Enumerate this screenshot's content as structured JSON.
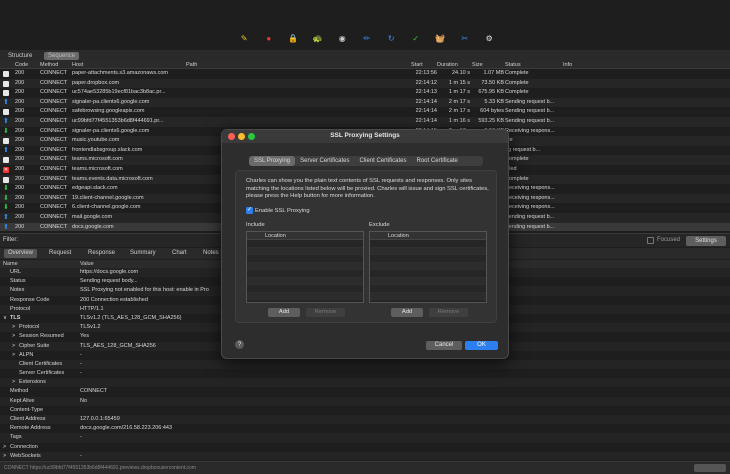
{
  "toolbar": {
    "icons": [
      "pen-icon",
      "record-icon",
      "lock-icon",
      "turtle-icon",
      "breakpoint-icon",
      "compose-icon",
      "repeat-icon",
      "validate-icon",
      "basket-icon",
      "tools-icon",
      "settings-icon"
    ],
    "icon_glyphs": [
      "✎",
      "●",
      "🔒",
      "🐢",
      "◉",
      "✏",
      "↻",
      "✓",
      "🧺",
      "✂",
      "⚙"
    ],
    "icon_colors": [
      "#e0c020",
      "#e53935",
      "#d0d0d0",
      "#d0d0d0",
      "#d0d0d0",
      "#3a8ff0",
      "#3a8ff0",
      "#3ac04a",
      "#3ac04a",
      "#3a8ff0",
      "#e0e0e0"
    ]
  },
  "view_tabs": {
    "structure": "Structure",
    "sequence": "Sequence"
  },
  "columns": [
    "Code",
    "Method",
    "Host",
    "Path",
    "Start",
    "Duration",
    "Size",
    "Status",
    "Info"
  ],
  "rows": [
    {
      "icon": "doc",
      "code": "200",
      "method": "CONNECT",
      "host": "paper-attachments.s3.amazonaws.com",
      "start": "22:13:56",
      "duration": "24.10 s",
      "size": "1.07 MB",
      "status": "Complete"
    },
    {
      "icon": "doc",
      "code": "200",
      "method": "CONNECT",
      "host": "paper.dropbox.com",
      "start": "22:14:12",
      "duration": "1 m 15 s",
      "size": "73.50 KB",
      "status": "Complete"
    },
    {
      "icon": "doc",
      "code": "200",
      "method": "CONNECT",
      "host": "uc574ae53285b19ecf81bac3b8ac.pr...",
      "start": "22:14:13",
      "duration": "1 m 17 s",
      "size": "675.95 KB",
      "status": "Complete"
    },
    {
      "icon": "up",
      "code": "200",
      "method": "CONNECT",
      "host": "signaler-pa.clients6.google.com",
      "start": "22:14:14",
      "duration": "2 m 17 s",
      "size": "5.33 KB",
      "status": "Sending request b..."
    },
    {
      "icon": "doc",
      "code": "200",
      "method": "CONNECT",
      "host": "safebrowsing.googleapis.com",
      "start": "22:14:14",
      "duration": "2 m 17 s",
      "size": "604 bytes",
      "status": "Sending request b..."
    },
    {
      "icon": "up",
      "code": "200",
      "method": "CONNECT",
      "host": "uc99bfd77f4551353b6d8f444691.pr...",
      "start": "22:14:14",
      "duration": "1 m 16 s",
      "size": "593.25 KB",
      "status": "Sending request b..."
    },
    {
      "icon": "down",
      "code": "200",
      "method": "CONNECT",
      "host": "signaler-pa.clients6.google.com",
      "start": "22:14:15",
      "duration": "2 m 17 s",
      "size": "8.50 KB",
      "status": "Receiving respons..."
    },
    {
      "icon": "doc",
      "code": "200",
      "method": "CONNECT",
      "host": "music.youtube.com",
      "start": "",
      "duration": "",
      "size": "",
      "status": "ete"
    },
    {
      "icon": "up",
      "code": "200",
      "method": "CONNECT",
      "host": "frontendlabsgroup.slack.com",
      "start": "",
      "duration": "",
      "size": "",
      "status": "ng request b..."
    },
    {
      "icon": "doc",
      "code": "200",
      "method": "CONNECT",
      "host": "teams.microsoft.com",
      "start": "",
      "duration": "",
      "size": "",
      "status": "Complete"
    },
    {
      "icon": "err",
      "code": "200",
      "method": "CONNECT",
      "host": "teams.microsoft.com",
      "start": "",
      "duration": "",
      "size": "",
      "status": "ailed"
    },
    {
      "icon": "doc",
      "code": "200",
      "method": "CONNECT",
      "host": "teams.events.data.microsoft.com",
      "start": "",
      "duration": "",
      "size": "",
      "status": "Complete"
    },
    {
      "icon": "down",
      "code": "200",
      "method": "CONNECT",
      "host": "edgeapi.slack.com",
      "start": "",
      "duration": "",
      "size": "",
      "status": "Receiving respons..."
    },
    {
      "icon": "down",
      "code": "200",
      "method": "CONNECT",
      "host": "19.client-channel.google.com",
      "start": "",
      "duration": "",
      "size": "",
      "status": "Receiving respons..."
    },
    {
      "icon": "down",
      "code": "200",
      "method": "CONNECT",
      "host": "6.client-channel.google.com",
      "start": "",
      "duration": "",
      "size": "",
      "status": "Receiving respons..."
    },
    {
      "icon": "up",
      "code": "200",
      "method": "CONNECT",
      "host": "mail.google.com",
      "start": "",
      "duration": "",
      "size": "",
      "status": "Sending request b..."
    },
    {
      "icon": "up",
      "code": "200",
      "method": "CONNECT",
      "host": "docs.google.com",
      "start": "",
      "duration": "",
      "size": "",
      "status": "Sending request b..."
    }
  ],
  "filter": {
    "label": "Filter:",
    "focused": "Focused",
    "settings": "Settings"
  },
  "detail_tabs": [
    "Overview",
    "Request",
    "Response",
    "Summary",
    "Chart",
    "Notes"
  ],
  "detail_columns": {
    "name": "Name",
    "value": "Value"
  },
  "detail_rows": [
    {
      "indent": 0,
      "arrow": "",
      "name": "URL",
      "value": "https://docs.google.com"
    },
    {
      "indent": 0,
      "arrow": "",
      "name": "Status",
      "value": "Sending request body..."
    },
    {
      "indent": 0,
      "arrow": "",
      "name": "Notes",
      "value": "SSL Proxying not enabled for this host: enable in Pro"
    },
    {
      "indent": 0,
      "arrow": "",
      "name": "Response Code",
      "value": "200 Connection established"
    },
    {
      "indent": 0,
      "arrow": "",
      "name": "Protocol",
      "value": "HTTP/1.1"
    },
    {
      "indent": 0,
      "arrow": "∨",
      "name": "TLS",
      "value": "TLSv1.2 (TLS_AES_128_GCM_SHA256)",
      "bold": true
    },
    {
      "indent": 1,
      "arrow": ">",
      "name": "Protocol",
      "value": "TLSv1.2"
    },
    {
      "indent": 1,
      "arrow": ">",
      "name": "Session Resumed",
      "value": "Yes"
    },
    {
      "indent": 1,
      "arrow": ">",
      "name": "Cipher Suite",
      "value": "TLS_AES_128_GCM_SHA256"
    },
    {
      "indent": 1,
      "arrow": ">",
      "name": "ALPN",
      "value": "-"
    },
    {
      "indent": 1,
      "arrow": "",
      "name": "Client Certificates",
      "value": "-"
    },
    {
      "indent": 1,
      "arrow": "",
      "name": "Server Certificates",
      "value": "-"
    },
    {
      "indent": 1,
      "arrow": ">",
      "name": "Extensions",
      "value": ""
    },
    {
      "indent": 0,
      "arrow": "",
      "name": "Method",
      "value": "CONNECT"
    },
    {
      "indent": 0,
      "arrow": "",
      "name": "Kept Alive",
      "value": "No"
    },
    {
      "indent": 0,
      "arrow": "",
      "name": "Content-Type",
      "value": ""
    },
    {
      "indent": 0,
      "arrow": "",
      "name": "Client Address",
      "value": "127.0.0.1:65459"
    },
    {
      "indent": 0,
      "arrow": "",
      "name": "Remote Address",
      "value": "docs.google.com/216.58.223.206:443"
    },
    {
      "indent": 0,
      "arrow": "",
      "name": "Tags",
      "value": "-"
    },
    {
      "indent": 0,
      "arrow": ">",
      "name": "Connection",
      "value": ""
    },
    {
      "indent": 0,
      "arrow": ">",
      "name": "WebSockets",
      "value": "-"
    }
  ],
  "statusbar": {
    "text": "CONNECT https://uc99bfd77f4551353b6d8f444691.previews.dropboxusercontent.com"
  },
  "modal": {
    "title": "SSL Proxying Settings",
    "tabs": [
      "SSL Proxying",
      "Server Certificates",
      "Client Certificates",
      "Root Certificate"
    ],
    "description": "Charles can show you the plain text contents of SSL requests and responses. Only sites matching the locations listed below will be proxied. Charles will issue and sign SSL certificates, please press the Help button for more information.",
    "enable_label": "Enable SSL Proxying",
    "include_label": "Include",
    "exclude_label": "Exclude",
    "location_header": "Location",
    "add": "Add",
    "remove": "Remove",
    "help": "?",
    "cancel": "Cancel",
    "ok": "OK"
  }
}
